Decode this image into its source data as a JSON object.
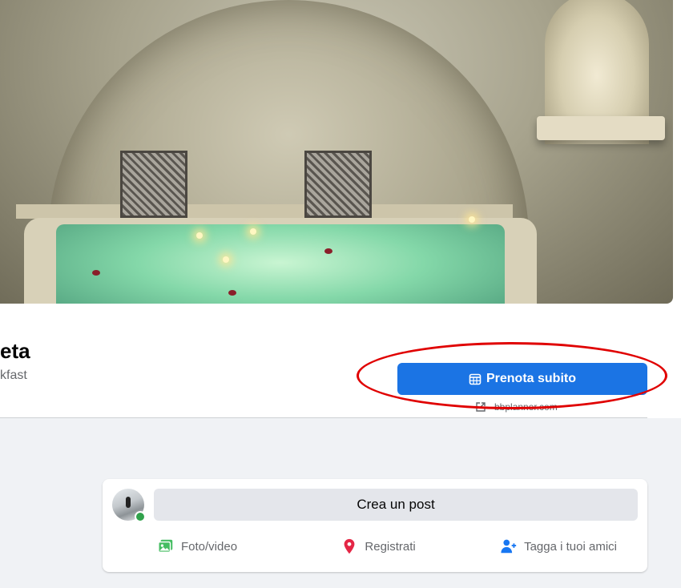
{
  "page": {
    "name": "eta",
    "category": "kfast"
  },
  "cta": {
    "book_label": "Prenota subito",
    "source_domain": "bbplanner.com"
  },
  "composer": {
    "create_post_label": "Crea un post",
    "actions": [
      {
        "label": "Foto/video",
        "icon": "photo-video-icon",
        "color": "#45bd62"
      },
      {
        "label": "Registrati",
        "icon": "location-pin-icon",
        "color": "#e42645"
      },
      {
        "label": "Tagga i tuoi amici",
        "icon": "tag-friends-icon",
        "color": "#1877f2"
      }
    ]
  },
  "colors": {
    "primary_button": "#1b74e4",
    "background": "#f0f2f5",
    "annotation": "#e00000",
    "online": "#31a24c"
  }
}
